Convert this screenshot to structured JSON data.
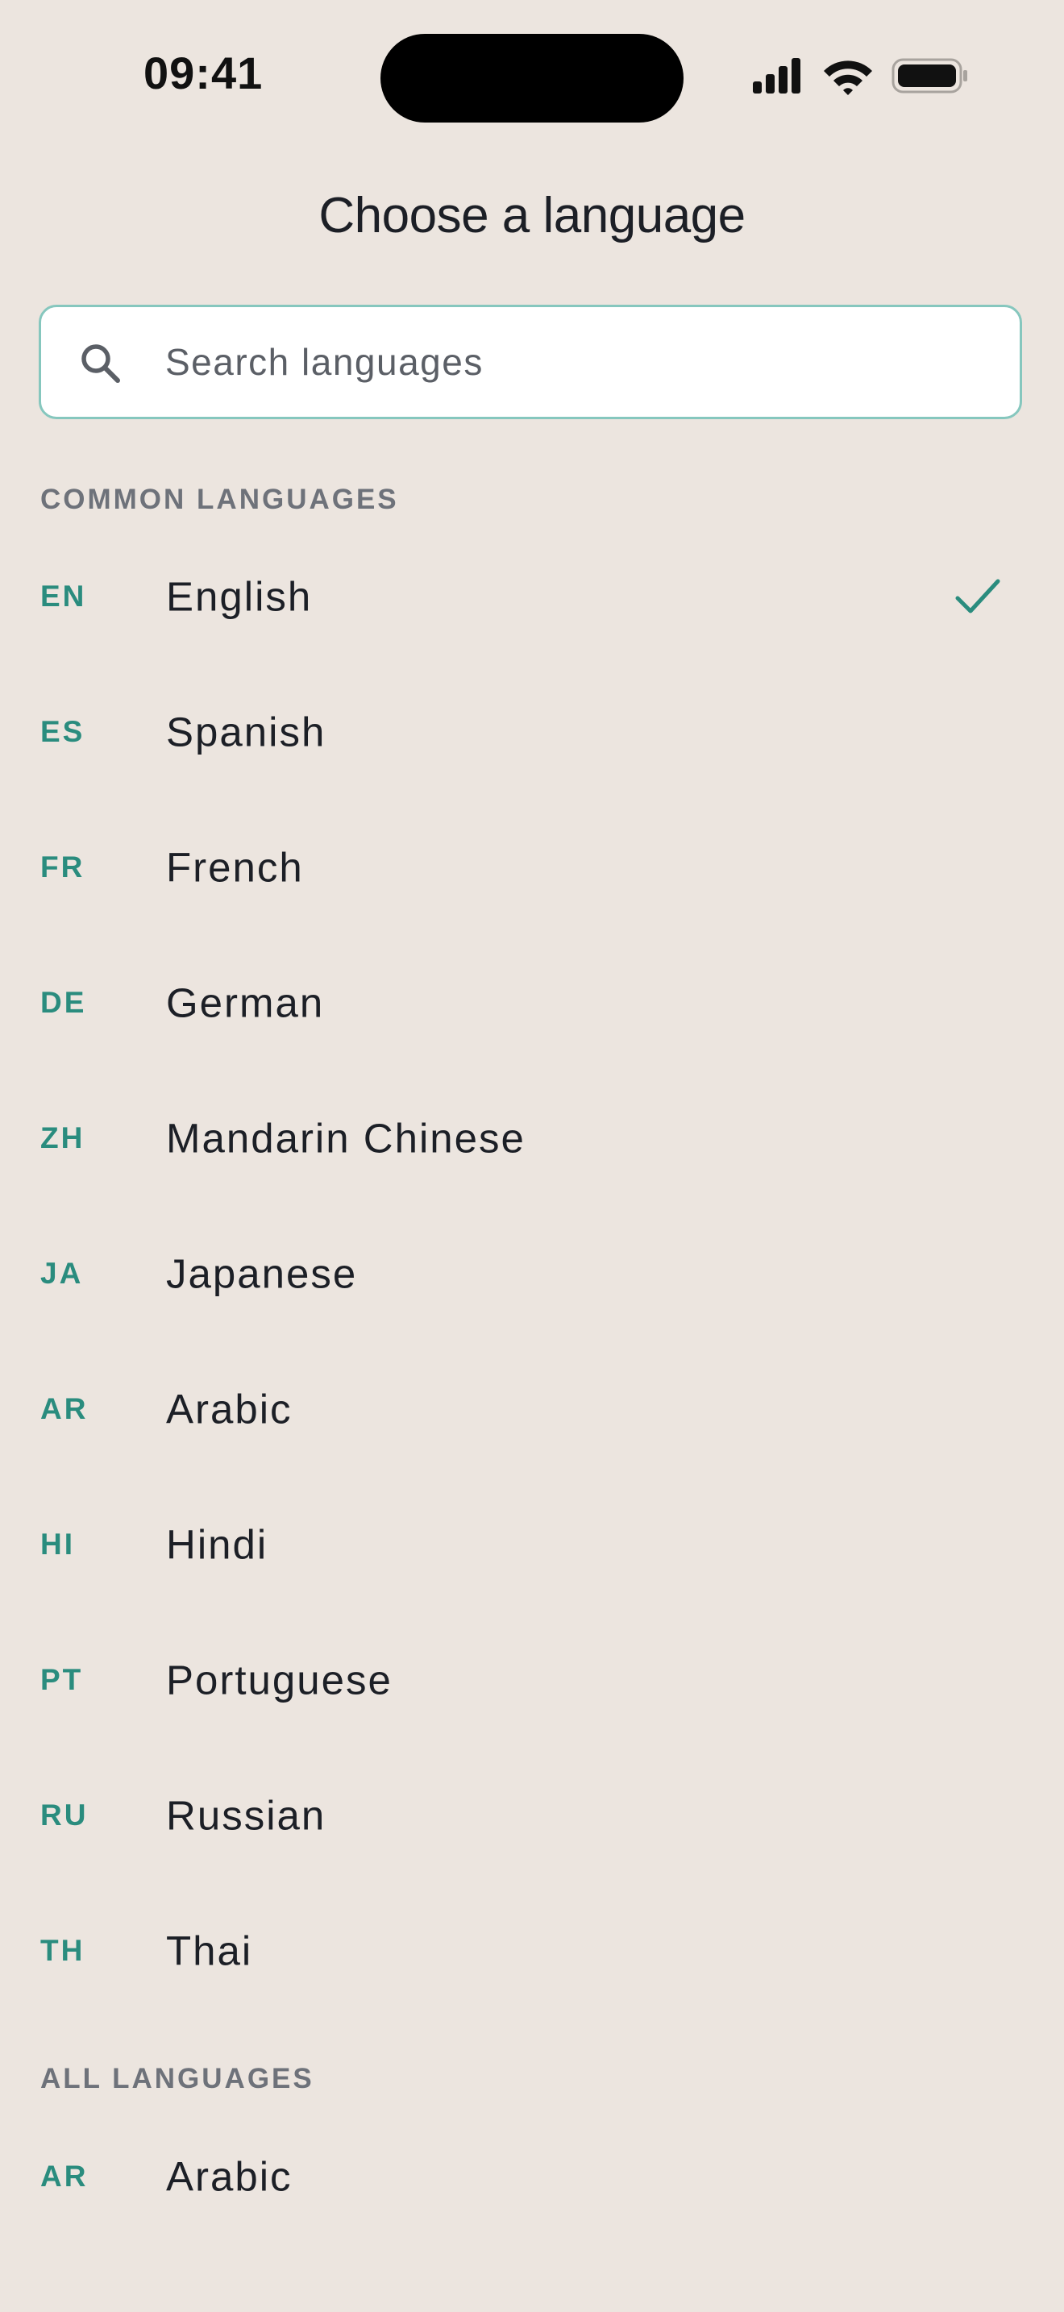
{
  "status_bar": {
    "time": "09:41"
  },
  "header": {
    "title": "Choose a language"
  },
  "search": {
    "placeholder": "Search languages",
    "value": ""
  },
  "sections": {
    "common": {
      "label": "COMMON LANGUAGES",
      "items": [
        {
          "code": "EN",
          "name": "English",
          "selected": true
        },
        {
          "code": "ES",
          "name": "Spanish"
        },
        {
          "code": "FR",
          "name": "French"
        },
        {
          "code": "DE",
          "name": "German"
        },
        {
          "code": "ZH",
          "name": "Mandarin Chinese"
        },
        {
          "code": "JA",
          "name": "Japanese"
        },
        {
          "code": "AR",
          "name": "Arabic"
        },
        {
          "code": "HI",
          "name": "Hindi"
        },
        {
          "code": "PT",
          "name": "Portuguese"
        },
        {
          "code": "RU",
          "name": "Russian"
        },
        {
          "code": "TH",
          "name": "Thai"
        }
      ]
    },
    "all": {
      "label": "ALL LANGUAGES",
      "items": [
        {
          "code": "AR",
          "name": "Arabic"
        }
      ]
    }
  },
  "colors": {
    "background": "#ECE5DF",
    "accent": "#2A8C7E",
    "search_border": "#86C7BE",
    "text_primary": "#1C1F26",
    "text_secondary": "#6E727A"
  }
}
